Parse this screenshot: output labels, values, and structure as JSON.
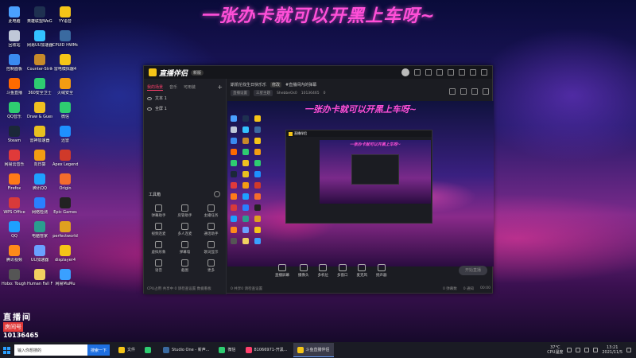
{
  "headline": "一张办卡就可以开黑上车呀~",
  "desktop_icons": [
    {
      "label": "此电脑",
      "color": "#4aa0ff"
    },
    {
      "label": "回收站",
      "color": "#c0c8d8"
    },
    {
      "label": "控制面板",
      "color": "#3a8af0"
    },
    {
      "label": "斗鱼直播",
      "color": "#ff6a00"
    },
    {
      "label": "QQ音乐",
      "color": "#2ecc71"
    },
    {
      "label": "Steam",
      "color": "#1b2838"
    },
    {
      "label": "网易云音乐",
      "color": "#e03a3a"
    },
    {
      "label": "Firefox",
      "color": "#ff7a18"
    },
    {
      "label": "WPS Office",
      "color": "#d83a3a"
    },
    {
      "label": "QQ",
      "color": "#1ea0ff"
    },
    {
      "label": "腾讯视频",
      "color": "#ff8a1a"
    },
    {
      "label": "Hobo: Tough Life",
      "color": "#555"
    },
    {
      "label": "英雄联盟WeGame版",
      "color": "#1e3050"
    },
    {
      "label": "网易UU加速器",
      "color": "#33c2ff"
    },
    {
      "label": "Counter-Strike: Global Off",
      "color": "#c78a2a"
    },
    {
      "label": "360安全卫士",
      "color": "#2ecc71"
    },
    {
      "label": "Draw & Guess",
      "color": "#f0c020"
    },
    {
      "label": "雷神加速器",
      "color": "#e8c020"
    },
    {
      "label": "向日葵",
      "color": "#f39c12"
    },
    {
      "label": "腾讯QQ",
      "color": "#1ea0ff"
    },
    {
      "label": "网络检测",
      "color": "#2a80ff"
    },
    {
      "label": "电脑管家",
      "color": "#2a9d8f"
    },
    {
      "label": "UU加速器",
      "color": "#6aa0ff"
    },
    {
      "label": "Human Fall Flat",
      "color": "#f0d060"
    },
    {
      "label": "YY语音",
      "color": "#f5c518"
    },
    {
      "label": "CPUID HWMonitor",
      "color": "#3a6aa0"
    },
    {
      "label": "雷电模拟器4",
      "color": "#f5c518"
    },
    {
      "label": "火绒安全",
      "color": "#f39c12"
    },
    {
      "label": "微信",
      "color": "#2ecc71"
    },
    {
      "label": "迅雷",
      "color": "#1e90ff"
    },
    {
      "label": "Apex Legends",
      "color": "#d03a2a"
    },
    {
      "label": "Origin",
      "color": "#f56c2d"
    },
    {
      "label": "Epic Games",
      "color": "#222"
    },
    {
      "label": "perfectworld",
      "color": "#e0a020"
    },
    {
      "label": "displayer4",
      "color": "#f5c518"
    },
    {
      "label": "网易MuMu",
      "color": "#3aa0ff"
    }
  ],
  "caption": {
    "top": "直播间",
    "tag": "房间号",
    "number": "10136465"
  },
  "app": {
    "name": "直播伴侣",
    "version": "新版",
    "tabs": [
      "我的场景",
      "音乐",
      "可用装"
    ],
    "scenes": [
      "文本 1",
      "全屏 1"
    ],
    "tools_title": "工具箱",
    "tools": [
      "弹幕助手",
      "房管助手",
      "主播任务",
      "视频连麦",
      "多人连麦",
      "通话助手",
      "虚拟形象",
      "弹幕墙",
      "歌词显示",
      "语音",
      "截图",
      "更多"
    ],
    "left_footer": "CPU占用  共享中 0  请检查设置  数据看板",
    "room_title": "斯凯伦找生日快乐乐",
    "room_badge": "修改",
    "room_notice": "#直播间内的弹幕",
    "room_meta": [
      "直播设置",
      "三星主题",
      "ShebbeOs0",
      "10136465",
      "0"
    ],
    "preview_headline": "一张办卡就可以开黑上车呀~",
    "nested_name": "直播伴侣",
    "nested_headline": "一张办卡就可以开黑上车呀~",
    "bottom_tools": [
      "直播屏幕",
      "摄像头",
      "多机位",
      "多窗口",
      "麦克风",
      "扬声器"
    ],
    "go_live": "开始直播",
    "status_left": "0  共享0  请检查设置",
    "status_right": [
      "0  弹幕数",
      "0  通知",
      "00:00"
    ]
  },
  "taskbar": {
    "search_placeholder": "输入你想搜的",
    "search_button": "搜索一下",
    "tasks": [
      {
        "label": "文件",
        "color": "#f5c518",
        "active": false
      },
      {
        "label": "",
        "color": "#2ecc71",
        "active": false
      },
      {
        "label": "Studio One - 新声...",
        "color": "#3a6aa0",
        "active": false
      },
      {
        "label": "微信",
        "color": "#2ecc71",
        "active": false
      },
      {
        "label": "81066971-开黑...",
        "color": "#ff3f6c",
        "active": false
      },
      {
        "label": "斗鱼直播伴侣",
        "color": "#f5c518",
        "active": true
      }
    ],
    "weather": "37°C",
    "weather_sub": "CPU温度",
    "time": "13:21",
    "date": "2021/11/5"
  }
}
